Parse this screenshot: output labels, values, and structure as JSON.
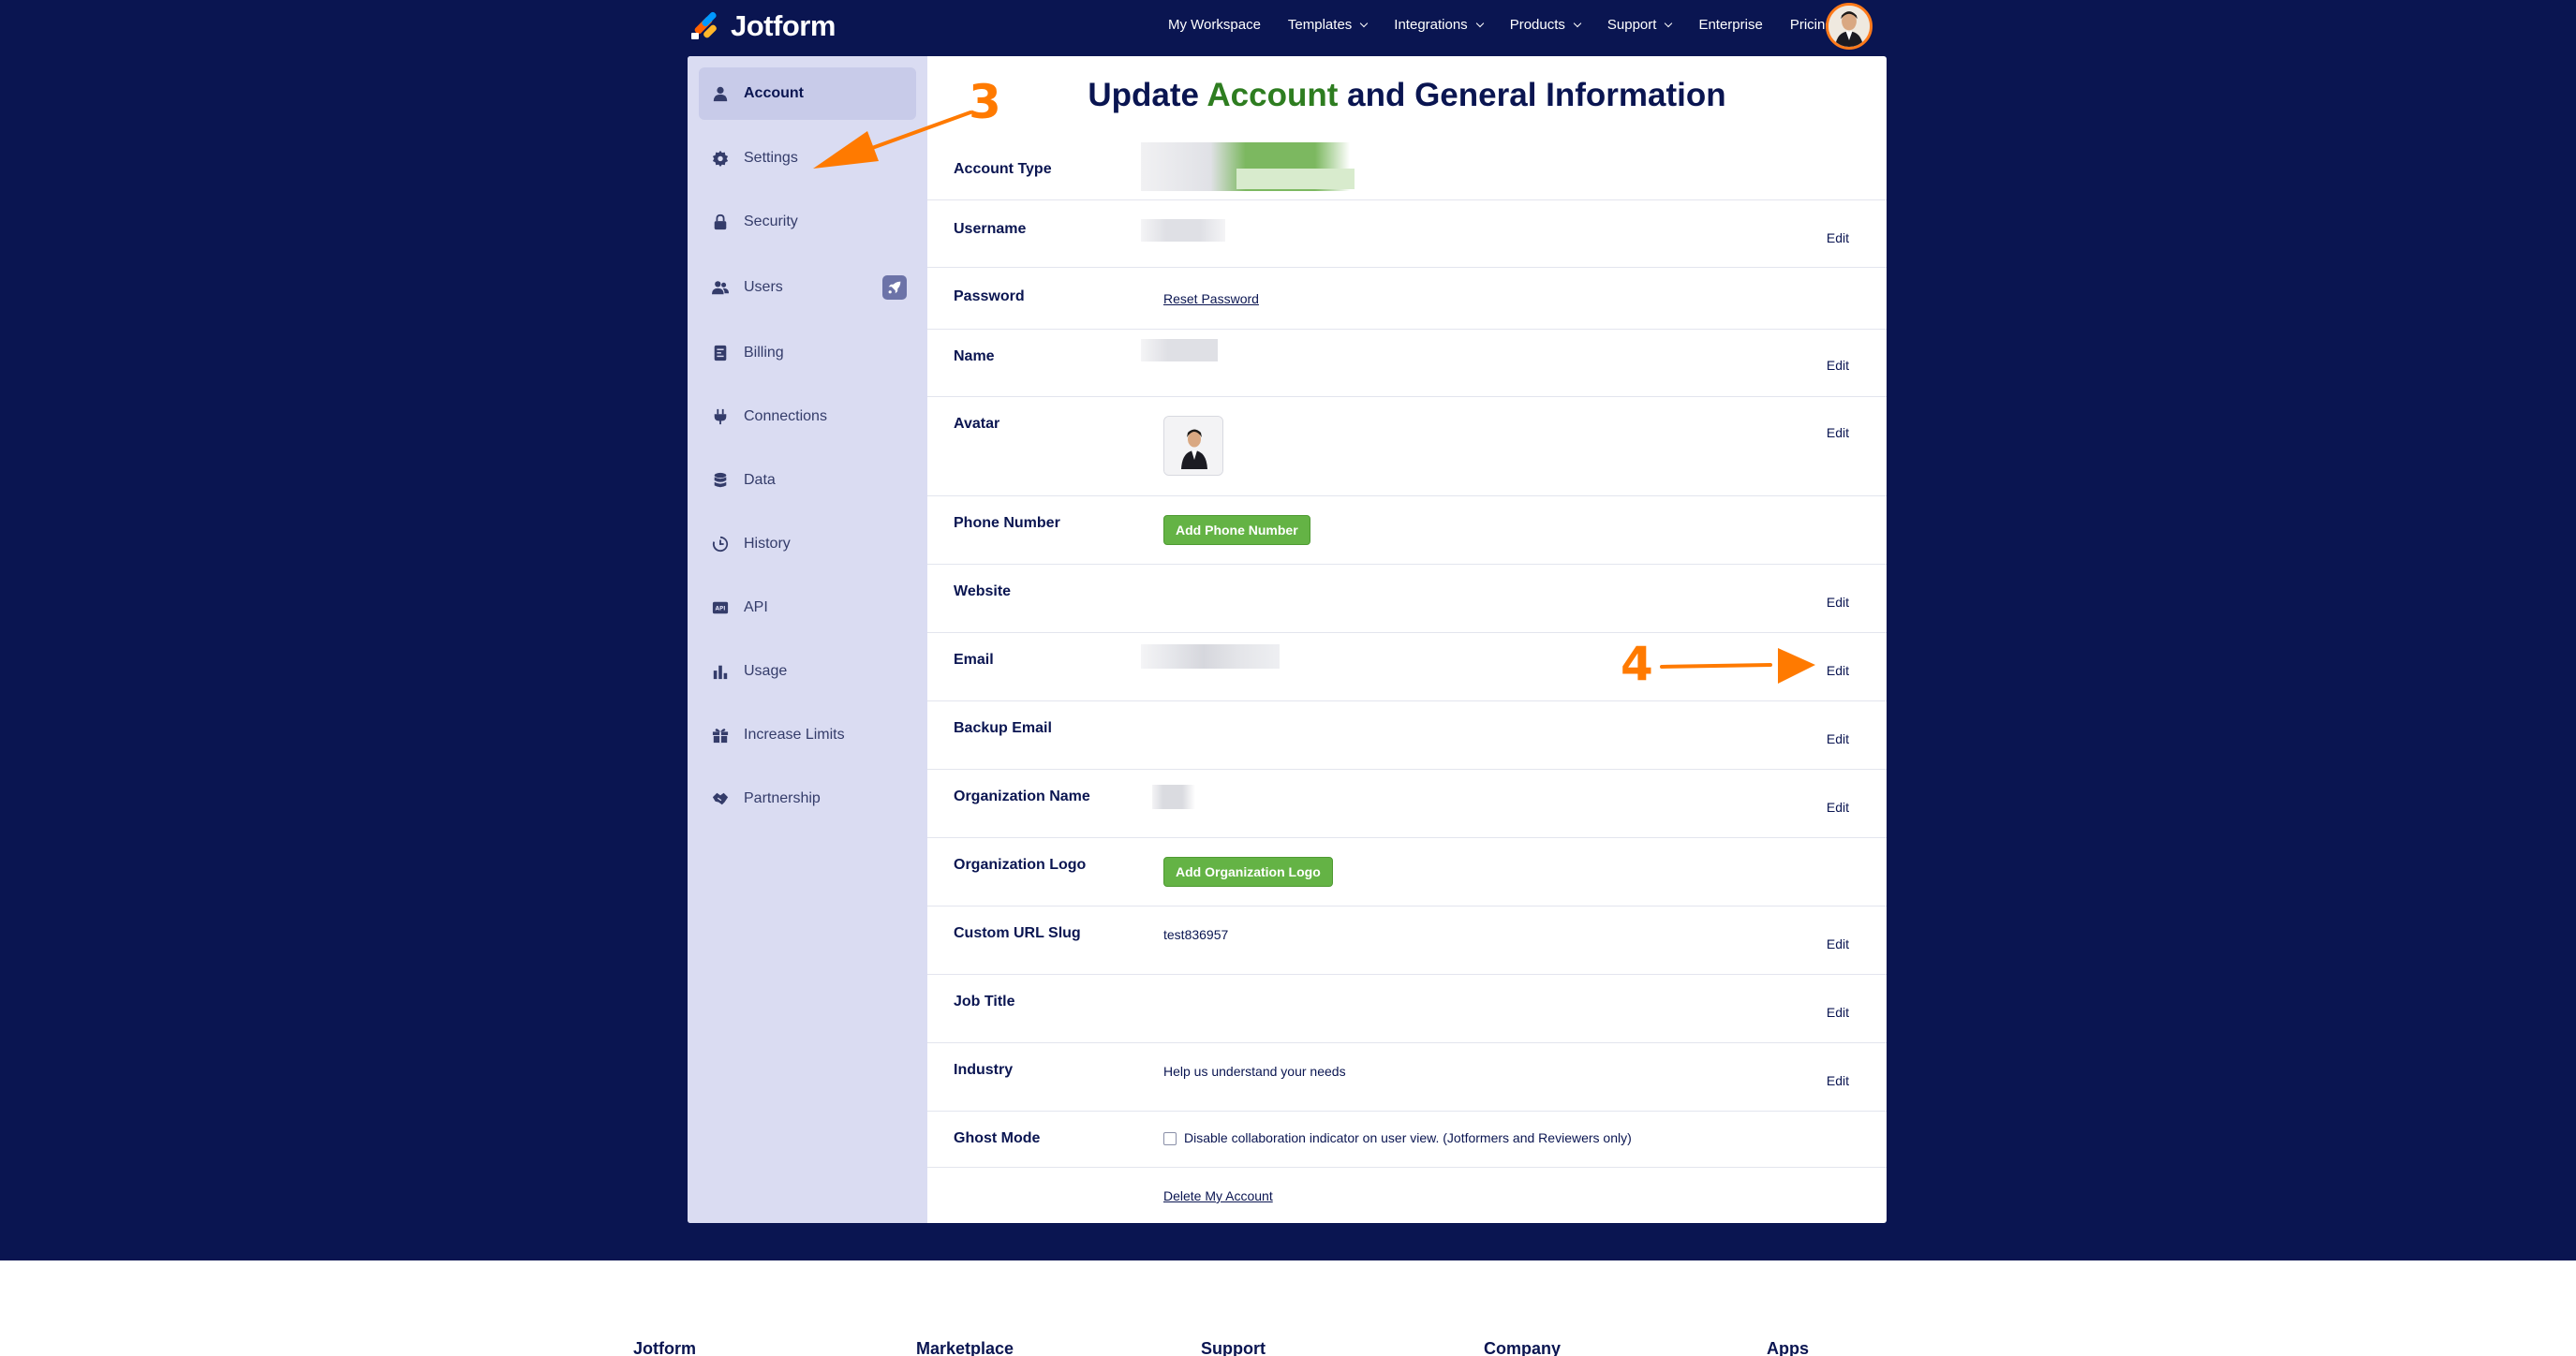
{
  "nav": {
    "brand": "Jotform",
    "items": [
      {
        "label": "My Workspace",
        "dropdown": false
      },
      {
        "label": "Templates",
        "dropdown": true
      },
      {
        "label": "Integrations",
        "dropdown": true
      },
      {
        "label": "Products",
        "dropdown": true
      },
      {
        "label": "Support",
        "dropdown": true
      },
      {
        "label": "Enterprise",
        "dropdown": false
      },
      {
        "label": "Pricing",
        "dropdown": false
      }
    ]
  },
  "sidebar": {
    "items": [
      {
        "label": "Account",
        "icon": "user-icon",
        "active": true
      },
      {
        "label": "Settings",
        "icon": "gear-icon"
      },
      {
        "label": "Security",
        "icon": "lock-icon"
      },
      {
        "label": "Users",
        "icon": "users-icon",
        "badge": "rocket-icon"
      },
      {
        "label": "Billing",
        "icon": "billing-icon"
      },
      {
        "label": "Connections",
        "icon": "plug-icon"
      },
      {
        "label": "Data",
        "icon": "database-icon"
      },
      {
        "label": "History",
        "icon": "history-icon"
      },
      {
        "label": "API",
        "icon": "api-icon"
      },
      {
        "label": "Usage",
        "icon": "bar-chart-icon"
      },
      {
        "label": "Increase Limits",
        "icon": "gift-icon"
      },
      {
        "label": "Partnership",
        "icon": "handshake-icon"
      }
    ]
  },
  "page": {
    "title_pre": "Update ",
    "title_green": "Account",
    "title_post": " and General Information"
  },
  "fields": {
    "account_type": {
      "label": "Account Type"
    },
    "username": {
      "label": "Username",
      "edit": "Edit"
    },
    "password": {
      "label": "Password",
      "link": "Reset Password"
    },
    "name": {
      "label": "Name",
      "edit": "Edit"
    },
    "avatar": {
      "label": "Avatar",
      "edit": "Edit"
    },
    "phone": {
      "label": "Phone Number",
      "button": "Add Phone Number"
    },
    "website": {
      "label": "Website",
      "edit": "Edit"
    },
    "email": {
      "label": "Email",
      "edit": "Edit"
    },
    "backup_email": {
      "label": "Backup Email",
      "edit": "Edit"
    },
    "org_name": {
      "label": "Organization Name",
      "edit": "Edit"
    },
    "org_logo": {
      "label": "Organization Logo",
      "button": "Add Organization Logo"
    },
    "url_slug": {
      "label": "Custom URL Slug",
      "value": "test836957",
      "edit": "Edit"
    },
    "job_title": {
      "label": "Job Title",
      "edit": "Edit"
    },
    "industry": {
      "label": "Industry",
      "value": "Help us understand your needs",
      "edit": "Edit"
    },
    "ghost_mode": {
      "label": "Ghost Mode",
      "checkbox_label": "Disable collaboration indicator on user view. (Jotformers and Reviewers only)",
      "checked": false
    },
    "delete": {
      "link": "Delete My Account"
    }
  },
  "annotations": {
    "step3": "3",
    "step4": "4",
    "color": "#ff7a00"
  },
  "footer": {
    "columns": [
      "Jotform",
      "Marketplace",
      "Support",
      "Company",
      "Apps"
    ]
  },
  "colors": {
    "navy": "#0a1551",
    "green_btn": "#64b345",
    "title_green": "#2e7d20",
    "sidebar_bg": "#dadcf2"
  }
}
